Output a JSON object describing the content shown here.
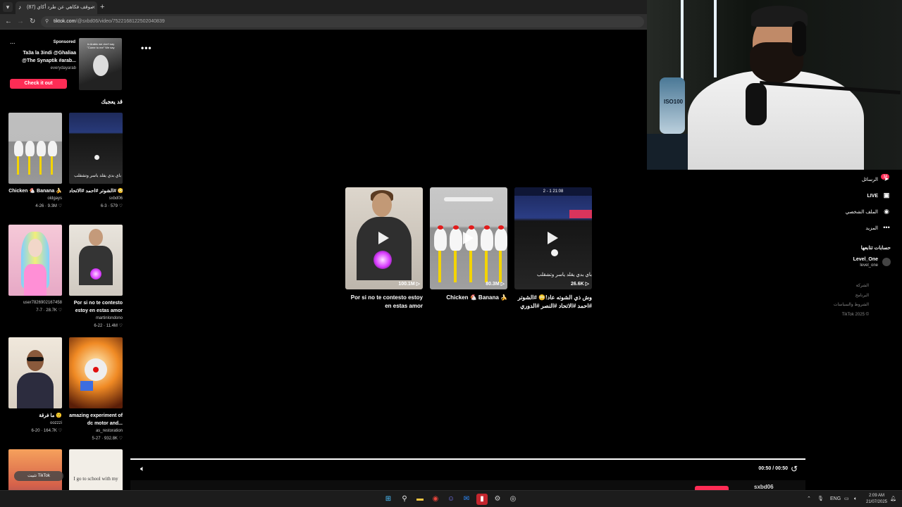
{
  "browser": {
    "tab_title": "موقف فكاهي عن طرد أكاي (87)",
    "tab_close": "×",
    "new_tab": "+",
    "url_host": "tiktok.com",
    "url_path": "/@sxbd06/video/7522168122502040839"
  },
  "sidebar": {
    "ad": {
      "dots": "...",
      "sponsored": "Sponsored",
      "title": "Ta3a la 3indi @Ghaliaa @The Synaptik #arab...",
      "handle": "everydayarab",
      "button": "Check it out",
      "thumb_caption": "in Arabic we don't say \"Come to me\" We say"
    },
    "like_title": "قد يعجبك",
    "cards": [
      {
        "title": "Chicken 🐔 Banana 🍌",
        "author": "oldgays",
        "date": "4-26",
        "views": "9.3M"
      },
      {
        "title": "وش ذي الشوته عاد!😳 #الشوتر #احمد #الاتحاد",
        "author": "sxbd06",
        "date": "6-3",
        "views": "579",
        "overlay": "باي بدي يقلد ياسر وتشقلب"
      },
      {
        "title": "",
        "author": "user7826902167458",
        "date": "7-7",
        "views": "28.7K"
      },
      {
        "title": "Por si no te contesto estoy en estas amor",
        "author": "martinlondono",
        "date": "6-22",
        "views": "11.4M"
      },
      {
        "title": "ما فرقة 🙂",
        "author": "oozzzi",
        "date": "6-20",
        "views": "164.7K"
      },
      {
        "title": "amazing experiment of dc motor and...",
        "author": "as_restoration",
        "date": "5-27",
        "views": "932.8K"
      },
      {
        "title": "",
        "author": "",
        "date": "",
        "views": "",
        "overlay": "I go to school with my"
      }
    ],
    "install_pill": "تثبيت TikTok"
  },
  "main": {
    "more": "•••",
    "videos": [
      {
        "title": "Por si no te contesto estoy en estas amor",
        "views": "100.1M"
      },
      {
        "title": "Chicken 🐔 Banana 🍌",
        "views": "80.3M"
      },
      {
        "title": "وش ذي الشوته عاد!😳 #الشوتر #احمد #الاتحاد #النصر #الدوري #الشوتر #التكيف...",
        "views": "26.6K",
        "overlay": "باي بدي يقلد ياسر وتشقلب",
        "score": "2 - 1  21:08"
      }
    ],
    "progress": 1.0,
    "time": "00:50 / 00:50",
    "username": "sxbd06"
  },
  "rightnav": {
    "messages": "الرسائل",
    "badge": "34",
    "live": "LIVE",
    "profile": "الملف الشخصي",
    "more": "المزيد",
    "following_title": "حسابات تتابعها",
    "follow_name": "Level_One",
    "follow_handle": "level_one",
    "footer": [
      "الشركة",
      "البرنامج",
      "الشروط والسياسات",
      "TikTok 2025 ©"
    ]
  },
  "webcam": {
    "can_label": "ISO100"
  },
  "taskbar": {
    "lang": "ENG",
    "time": "2:09 AM",
    "date": "21/07/2025"
  },
  "colors": {
    "accent": "#fe2c55",
    "background": "#000000",
    "taskbar": "#1c1c1c"
  }
}
